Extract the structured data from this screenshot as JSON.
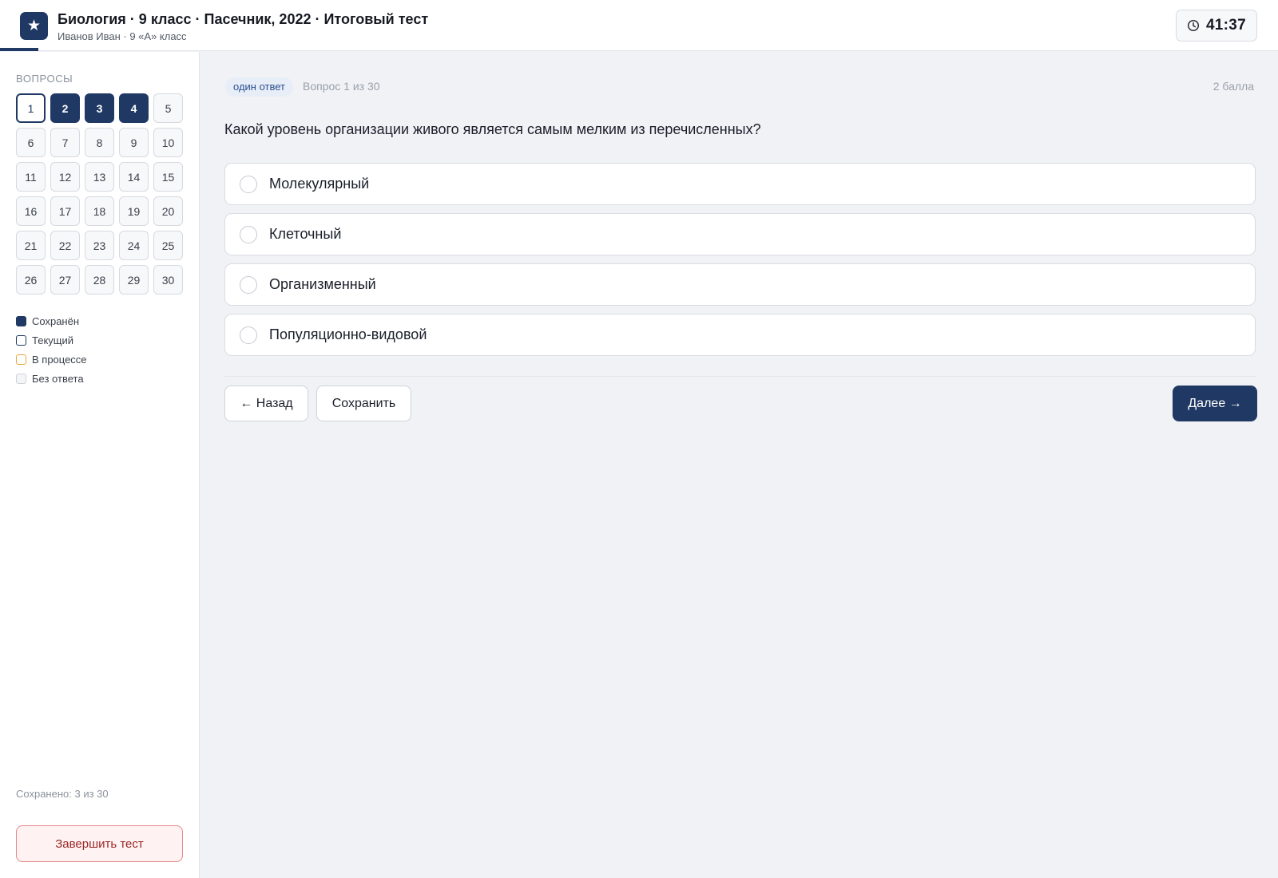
{
  "colors": {
    "accent": "#203864",
    "in_progress": "#e8a73a",
    "danger": "#9b2727"
  },
  "header": {
    "logo_icon": "star-icon",
    "logo_glyph": "★",
    "title": "Биология · 9 класс · Пасечник, 2022 · Итоговый тест",
    "subtitle": "Иванов Иван · 9 «А» класс",
    "progress_fraction": 0.03,
    "timer": {
      "icon": "clock-icon",
      "value": "41:37"
    }
  },
  "sidebar": {
    "title": "ВОПРОСЫ",
    "questions": [
      {
        "label": "1",
        "state": "current"
      },
      {
        "label": "2",
        "state": "saved"
      },
      {
        "label": "3",
        "state": "saved"
      },
      {
        "label": "4",
        "state": "saved"
      },
      {
        "label": "5",
        "state": "empty"
      },
      {
        "label": "6",
        "state": "empty"
      },
      {
        "label": "7",
        "state": "empty"
      },
      {
        "label": "8",
        "state": "empty"
      },
      {
        "label": "9",
        "state": "empty"
      },
      {
        "label": "10",
        "state": "empty"
      },
      {
        "label": "11",
        "state": "empty"
      },
      {
        "label": "12",
        "state": "empty"
      },
      {
        "label": "13",
        "state": "empty"
      },
      {
        "label": "14",
        "state": "empty"
      },
      {
        "label": "15",
        "state": "empty"
      },
      {
        "label": "16",
        "state": "empty"
      },
      {
        "label": "17",
        "state": "empty"
      },
      {
        "label": "18",
        "state": "empty"
      },
      {
        "label": "19",
        "state": "empty"
      },
      {
        "label": "20",
        "state": "empty"
      },
      {
        "label": "21",
        "state": "empty"
      },
      {
        "label": "22",
        "state": "empty"
      },
      {
        "label": "23",
        "state": "empty"
      },
      {
        "label": "24",
        "state": "empty"
      },
      {
        "label": "25",
        "state": "empty"
      },
      {
        "label": "26",
        "state": "empty"
      },
      {
        "label": "27",
        "state": "empty"
      },
      {
        "label": "28",
        "state": "empty"
      },
      {
        "label": "29",
        "state": "empty"
      },
      {
        "label": "30",
        "state": "empty"
      }
    ],
    "legend": {
      "saved": "Сохранён",
      "current": "Текущий",
      "in_progress": "В процессе",
      "no_answer": "Без ответа"
    },
    "saved_count": "Сохранено: 3 из 30",
    "finish_label": "Завершить тест"
  },
  "question": {
    "type_chip": "один ответ",
    "counter": "Вопрос 1 из 30",
    "points": "2 балла",
    "text": "Какой уровень организации живого является самым мелким из перечисленных?",
    "options": [
      "Молекулярный",
      "Клеточный",
      "Организменный",
      "Популяционно-видовой"
    ]
  },
  "nav": {
    "back_label": "← Назад",
    "save_label": "Сохранить",
    "next_label": "Далее →"
  }
}
